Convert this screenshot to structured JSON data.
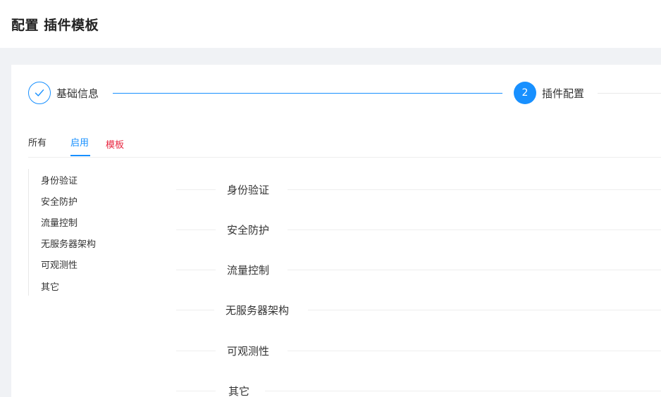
{
  "header": {
    "title": "配置 插件模板"
  },
  "steps": [
    {
      "label": "基础信息",
      "status": "done"
    },
    {
      "label": "插件配置",
      "number": "2",
      "status": "active"
    }
  ],
  "tabs": [
    {
      "label": "所有"
    },
    {
      "label": "启用",
      "active": true
    },
    {
      "label": "模板"
    }
  ],
  "side_nav": [
    "身份验证",
    "安全防护",
    "流量控制",
    "无服务器架构",
    "可观测性",
    "其它"
  ],
  "sections": [
    "身份验证",
    "安全防护",
    "流量控制",
    "无服务器架构",
    "可观测性",
    "其它"
  ],
  "colors": {
    "primary": "#1890ff",
    "template_tab": "#e8253f",
    "divider": "#eeeeee"
  }
}
